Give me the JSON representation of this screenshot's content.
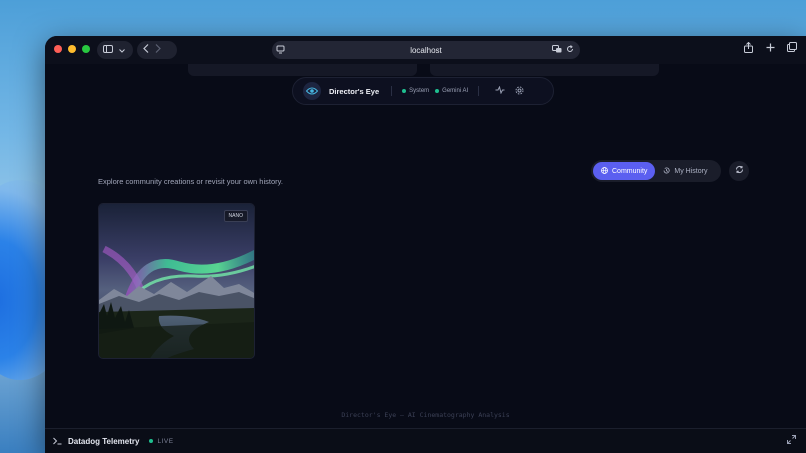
{
  "browser": {
    "url": "localhost"
  },
  "header": {
    "app_name": "Director's Eye",
    "status": [
      {
        "label": "System",
        "color": "#1fbf8f"
      },
      {
        "label": "Gemini AI",
        "color": "#1fbf8f"
      }
    ]
  },
  "main": {
    "subtitle": "Explore community creations or revisit your own history.",
    "tabs": [
      {
        "label": "Community",
        "icon": "globe-icon",
        "active": true
      },
      {
        "label": "My History",
        "icon": "history-icon",
        "active": false
      }
    ],
    "gallery": [
      {
        "badge": "NANO",
        "scene": "aurora-over-mountains-and-river"
      }
    ]
  },
  "footer": {
    "text": "Director's Eye — AI Cinematography Analysis"
  },
  "telemetry": {
    "title": "Datadog Telemetry",
    "status": "LIVE"
  },
  "colors": {
    "accent": "#5b5ff0",
    "status_ok": "#1fbf8f",
    "background": "#080b17"
  }
}
